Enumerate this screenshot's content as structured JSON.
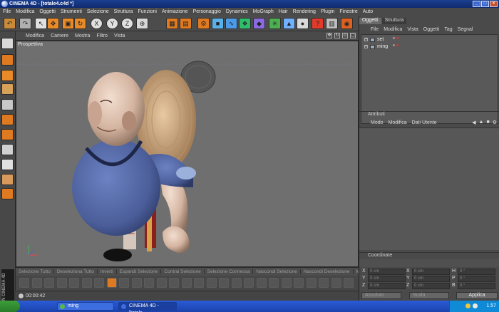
{
  "window": {
    "title": "CINEMA 4D - [totale4.c4d *]"
  },
  "menu": [
    "File",
    "Modifica",
    "Oggetti",
    "Strumenti",
    "Selezione",
    "Struttura",
    "Funzioni",
    "Animazione",
    "Personaggio",
    "Dynamics",
    "MoGraph",
    "Hair",
    "Rendering",
    "Plugin",
    "Finestre",
    "Auto"
  ],
  "viewport": {
    "menu": [
      "Modifica",
      "Camere",
      "Mostra",
      "Filtro",
      "Vista"
    ],
    "label": "Prospettiva",
    "ctrl_icons": [
      "move-icon",
      "rotate-icon",
      "zoom-icon",
      "maximize-icon"
    ]
  },
  "objects_panel": {
    "tabs": [
      "Oggetti",
      "Struttura"
    ],
    "active_tab": 0,
    "menu": [
      "File",
      "Modifica",
      "Vista",
      "Oggetti",
      "Tag",
      "Segnal"
    ],
    "items": [
      "set",
      "ming"
    ]
  },
  "attributes_panel": {
    "title": "Attributi",
    "menu": [
      "Modo",
      "Modifica",
      "Dati Utente"
    ]
  },
  "coords_panel": {
    "title": "Coordinate",
    "rows": [
      {
        "a": "X",
        "b": "X",
        "c": "H"
      },
      {
        "a": "Y",
        "b": "Y",
        "c": "P"
      },
      {
        "a": "Z",
        "b": "Z",
        "c": "B"
      }
    ],
    "field_value": "0 cm",
    "field_angle": "0 °",
    "mode_select": "Assoluto",
    "scale_select": "Scala",
    "apply_label": "Applica"
  },
  "actionbar": [
    "Selezione Tutto",
    "Deseleziona Tutto",
    "Inverti",
    "Espandi Selezione",
    "Contrai Selezione",
    "Selezione Connessa",
    "Nascondi Selezione",
    "Nascondi Deselezione",
    "Mostra Tutto",
    "Sele"
  ],
  "timeline": {
    "time": "00:00:42"
  },
  "brand": "MAXON CINEMA 4D",
  "taskbar": {
    "tasks": [
      {
        "label": "ming",
        "active": false
      },
      {
        "label": "CINEMA 4D - [totale...",
        "active": true
      }
    ],
    "clock": "1.57"
  },
  "colors": {
    "accent": "#e05a1b",
    "titlebar": "#1b3f90",
    "panel_bg": "#4a4a4a",
    "viewport_bg": "#6f6f6f",
    "robe": "#4b5e9a"
  },
  "icons": {
    "toolbar": [
      "undo-icon",
      "redo-icon",
      "select-arrow-icon",
      "move-icon",
      "scale-icon",
      "rotate-icon",
      "x-axis-icon",
      "y-axis-icon",
      "z-axis-icon",
      "world-coords-icon",
      "render-view-icon",
      "render-picture-icon",
      "render-settings-icon",
      "cube-primitive-icon",
      "spline-icon",
      "nurbs-icon",
      "deformer-icon",
      "scene-icon",
      "camera-icon",
      "light-icon",
      "help-icon",
      "layout-icon",
      "sphere-icon"
    ],
    "left": [
      "model-mode-icon",
      "object-mode-icon",
      "axis-mode-icon",
      "points-mode-icon",
      "edges-mode-icon",
      "polygons-mode-icon",
      "texture-mode-icon",
      "checker-mode-icon",
      "lock-icon",
      "paint-mode-icon",
      "sculpt-mode-icon"
    ]
  }
}
